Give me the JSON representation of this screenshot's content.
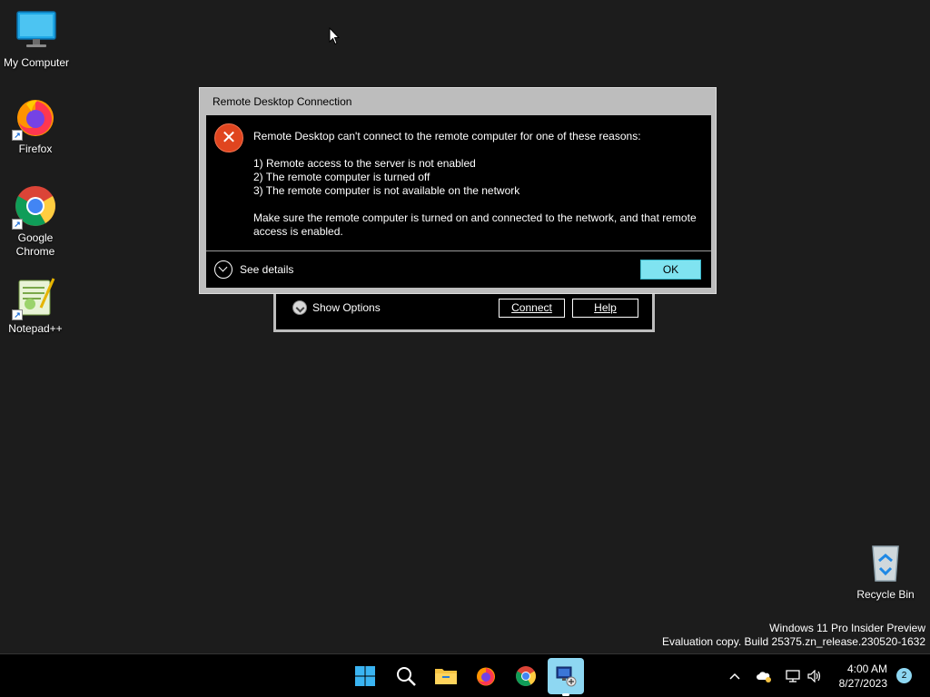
{
  "desktop": {
    "icons": [
      {
        "label": "My Computer"
      },
      {
        "label": "Firefox"
      },
      {
        "label": "Google Chrome"
      },
      {
        "label": "Notepad++"
      },
      {
        "label": "Recycle Bin"
      }
    ]
  },
  "rdc_window": {
    "show_options": "Show Options",
    "connect": "Connect",
    "help": "Help"
  },
  "error_dialog": {
    "title": "Remote Desktop Connection",
    "heading": "Remote Desktop can't connect to the remote computer for one of these reasons:",
    "reasons": [
      "1) Remote access to the server is not enabled",
      "2) The remote computer is turned off",
      "3) The remote computer is not available on the network"
    ],
    "advice": "Make sure the remote computer is turned on and connected to the network, and that remote access is enabled.",
    "see_details": "See details",
    "ok": "OK",
    "icon": "error-icon",
    "icon_color": "#e0451f"
  },
  "watermark": {
    "line1": "Windows 11 Pro Insider Preview",
    "line2": "Evaluation copy. Build 25375.zn_release.230520-1632"
  },
  "taskbar": {
    "icons": [
      "start-icon",
      "search-icon",
      "file-explorer-icon",
      "firefox-icon",
      "chrome-icon",
      "remote-desktop-icon"
    ],
    "time": "4:00 AM",
    "date": "8/27/2023",
    "notification_count": "2",
    "accent": "#8ed7f2"
  }
}
